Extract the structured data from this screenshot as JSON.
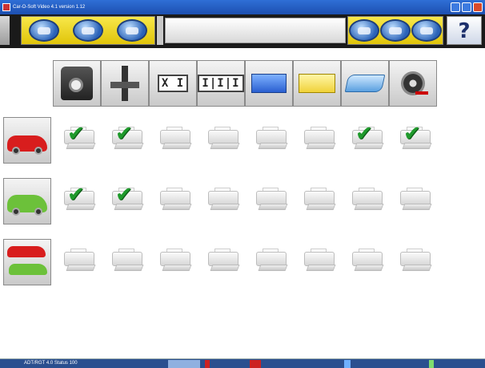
{
  "window": {
    "title": "Car-O-Soft Video 4.1 version 1.12"
  },
  "toolbar": {
    "left_buttons": [
      "vehicle-icon",
      "steering-icon",
      "print-icon"
    ],
    "right_buttons": [
      "measure-icon",
      "database-icon",
      "settings-icon"
    ],
    "help_label": "?"
  },
  "header": {
    "columns": [
      {
        "icon": "measuring-head-icon"
      },
      {
        "icon": "lift-icon"
      },
      {
        "icon": "text-box-icon",
        "label": "X I"
      },
      {
        "icon": "text-box-icon",
        "label": "I|I|I"
      },
      {
        "icon": "blue-panel-icon"
      },
      {
        "icon": "yellow-panel-icon"
      },
      {
        "icon": "chassis-icon"
      },
      {
        "icon": "wheel-icon"
      }
    ]
  },
  "vehicles": [
    {
      "icon": "red-car-icon",
      "color": "#d81d1d"
    },
    {
      "icon": "green-car-icon",
      "color": "#6cc13a"
    },
    {
      "icon": "red-green-cars-icon",
      "color": "#d81d1d"
    }
  ],
  "grid": [
    [
      "check",
      "check",
      "printer",
      "printer",
      "printer",
      "printer",
      "check",
      "check"
    ],
    [
      "check",
      "check",
      "printer",
      "printer",
      "printer",
      "printer",
      "printer",
      "printer"
    ],
    [
      "printer",
      "printer",
      "printer",
      "printer",
      "printer",
      "printer",
      "printer",
      "printer"
    ]
  ],
  "statusbar": {
    "text": "ADT/RGT 4.0    Status  100"
  },
  "colors": {
    "toolbar_yellow": "#f0d627",
    "check_green": "#1f9a2c",
    "titlebar_blue": "#2f6fd6"
  }
}
